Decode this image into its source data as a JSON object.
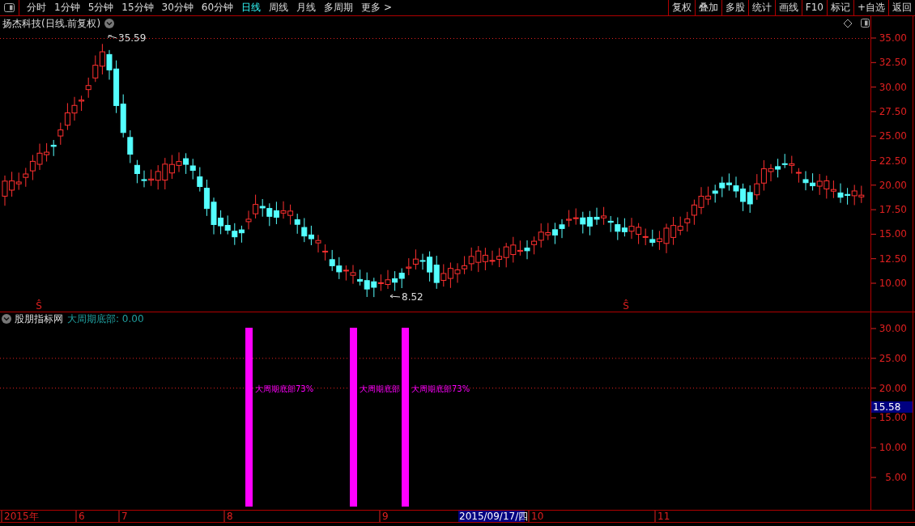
{
  "toolbar": {
    "periods": [
      {
        "label": "分时",
        "selected": false
      },
      {
        "label": "1分钟",
        "selected": false
      },
      {
        "label": "5分钟",
        "selected": false
      },
      {
        "label": "15分钟",
        "selected": false
      },
      {
        "label": "30分钟",
        "selected": false
      },
      {
        "label": "60分钟",
        "selected": false
      },
      {
        "label": "日线",
        "selected": true
      },
      {
        "label": "周线",
        "selected": false
      },
      {
        "label": "月线",
        "selected": false
      },
      {
        "label": "多周期",
        "selected": false
      },
      {
        "label": "更多 >",
        "selected": false
      }
    ],
    "buttons": [
      "复权",
      "叠加",
      "多股",
      "统计",
      "画线",
      "F10",
      "标记",
      "+自选",
      "返回"
    ]
  },
  "price_panel": {
    "title": "扬杰科技(日线.前复权)",
    "high_label": "35.59",
    "low_label": "8.52",
    "markers": [
      "Ŝ",
      "Ŝ"
    ],
    "axis_ticks": [
      "35.00",
      "32.50",
      "30.00",
      "27.50",
      "25.00",
      "22.50",
      "20.00",
      "17.50",
      "15.00",
      "12.50",
      "10.00"
    ]
  },
  "indicator_panel": {
    "source": "股朋指标网",
    "readout": "大周期底部: 0.00",
    "signals": [
      {
        "label": "大周期底部73%"
      },
      {
        "label": "大周期底部"
      },
      {
        "label": "大周期底部73%"
      }
    ],
    "axis_ticks": [
      "30.00",
      "25.00",
      "20.00",
      "15.00",
      "10.00",
      "5.00"
    ],
    "current_value": "15.58"
  },
  "date_axis": {
    "labels": [
      "2015年",
      "6",
      "7",
      "8",
      "9",
      "10",
      "11"
    ],
    "cursor_date": "2015/09/17/四"
  }
}
